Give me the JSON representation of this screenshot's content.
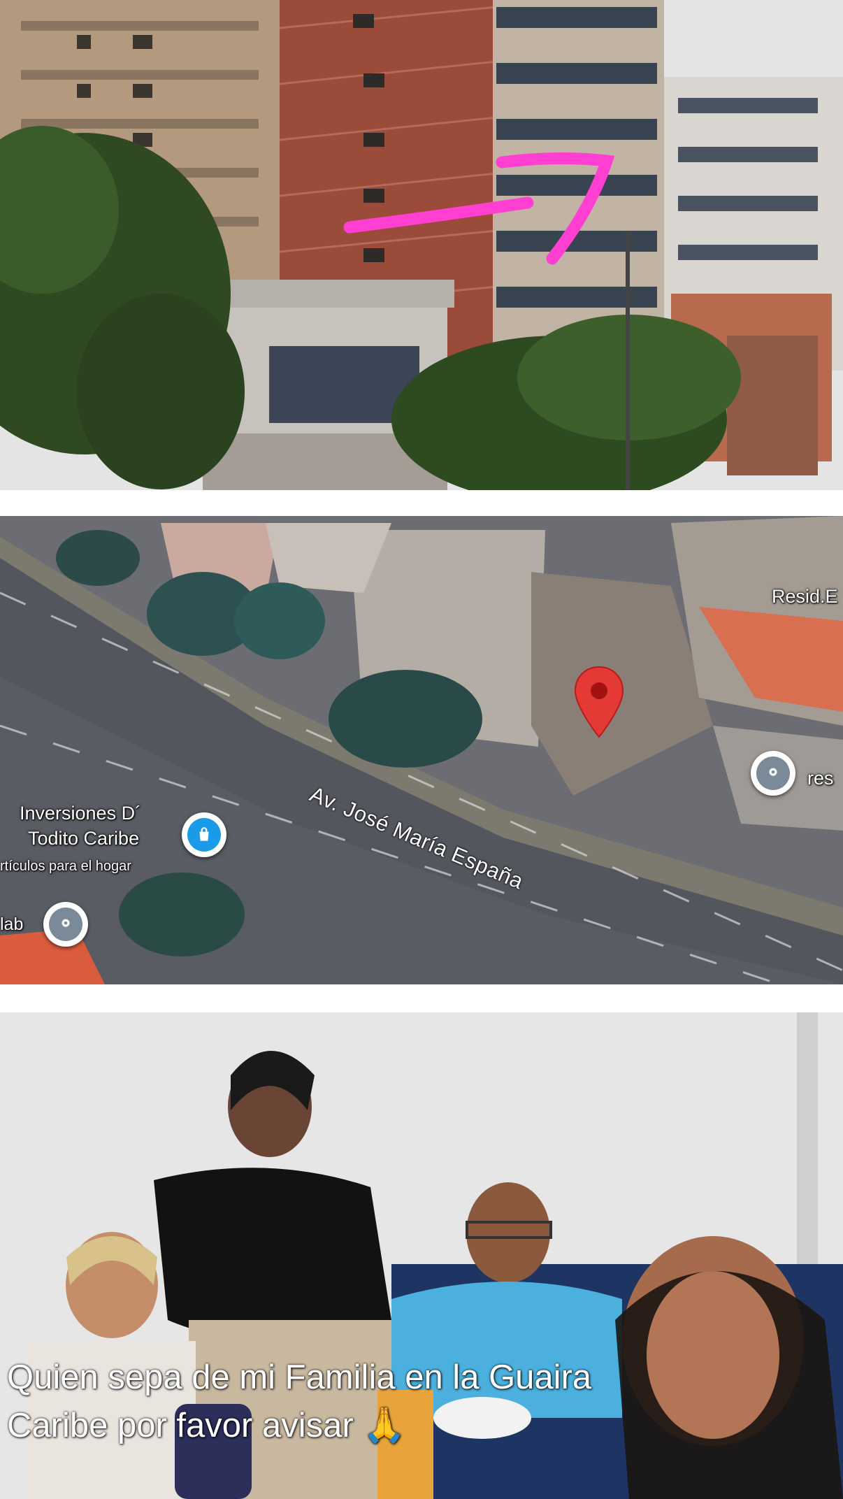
{
  "colors": {
    "marker_red": "#e53935",
    "poi_blue": "#1a9be8",
    "poi_gray": "#7a8a99",
    "highlight_pink": "#ff3fd2"
  },
  "photos": {
    "top": {
      "icon": "building-photo"
    },
    "bottom": {
      "icon": "family-photo"
    }
  },
  "map": {
    "street_name": "Av. José María España",
    "labels": {
      "resid": "Resid.E",
      "res": "res",
      "store_line1": "Inversiones D´",
      "store_line2": "Todito Caribe",
      "store_line3": "rtículos para el hogar",
      "lab": "lab"
    },
    "icons": {
      "location": "location-pin-icon",
      "shopping": "shopping-bag-icon",
      "place": "place-marker-icon"
    }
  },
  "caption": {
    "line1": "Quien sepa de mi Familia en la Guaira",
    "line2": "Caribe por favor avisar",
    "emoji": "🙏"
  }
}
